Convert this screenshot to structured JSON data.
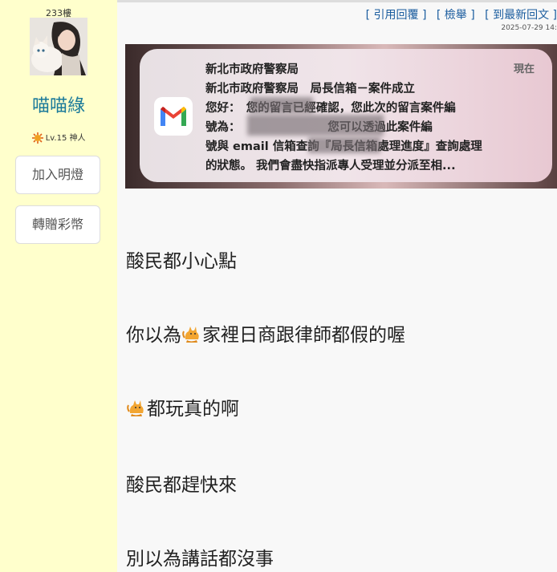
{
  "sidebar": {
    "floor": "233樓",
    "username": "喵喵綠",
    "level": "Lv.15 神人",
    "buttons": [
      "加入明燈",
      "轉贈彩幣"
    ]
  },
  "header": {
    "actions": [
      "[ 引用回覆 ]",
      "[ 檢舉 ]",
      "[ 到最新回文 ]"
    ],
    "timestamp": "2025-07-29 14:"
  },
  "notification": {
    "sender": "新北市政府警察局",
    "subject": "新北市政府警察局　局長信箱－案件成立",
    "time": "現在",
    "lines": [
      "您好：　您的留言已經確認，您此次的留言案件編",
      "號為：　　　　　　　　您可以透過此案件編",
      "號與 email 信箱查詢『局長信箱處理進度』查詢處理",
      "的狀態。 我們會盡快指派專人受理並分派至相..."
    ],
    "icon": "gmail-icon",
    "colors": {
      "red": "#ea4335",
      "blue": "#4285f4",
      "green": "#34a853",
      "yellow": "#fbbc04"
    }
  },
  "post": {
    "p1": "酸民都小心點",
    "p2_before": "你以為",
    "p2_after": "家裡日商跟律師都假的喔",
    "p3_after": "都玩真的啊",
    "p4": "酸民都趕快來",
    "p5": "別以為講話都沒事",
    "emoji_icon": "cat-emoji-icon"
  }
}
